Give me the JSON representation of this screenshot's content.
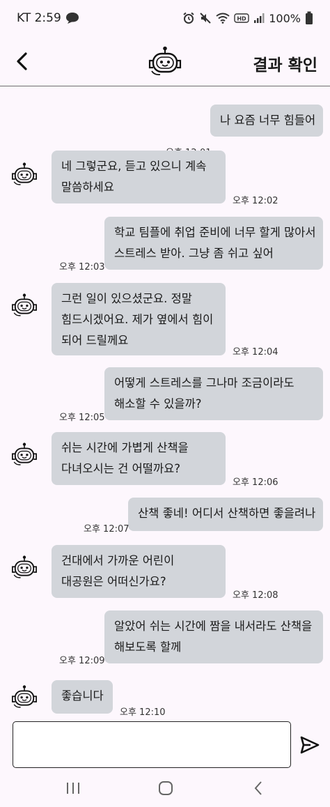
{
  "status_bar": {
    "carrier_time": "KT 2:59",
    "battery": "100%",
    "icons": [
      "chat-bubble-icon",
      "alarm-icon",
      "mute-icon",
      "wifi-icon",
      "hd-icon",
      "signal-icon",
      "battery-icon"
    ]
  },
  "header": {
    "back_icon": "chevron-left-icon",
    "bot_icon": "robot-icon",
    "result_label": "결과 확인"
  },
  "messages": [
    {
      "sender": "user",
      "lines": [
        "나 요즘 너무 힘들어"
      ],
      "time": "오후 12:01"
    },
    {
      "sender": "bot",
      "lines": [
        "네 그렇군요, 듣고 있으니 계속",
        "말씀하세요"
      ],
      "time": "오후 12:02"
    },
    {
      "sender": "user",
      "lines": [
        "학교 팀플에 취업 준비에 너무 할게 많아서",
        "스트레스 받아. 그냥 좀 쉬고 싶어"
      ],
      "time": "오후 12:03"
    },
    {
      "sender": "bot",
      "lines": [
        "그런 일이 있으셨군요. 정말",
        "힘드시겠어요. 제가 옆에서 힘이",
        "되어 드릴께요"
      ],
      "time": "오후 12:04"
    },
    {
      "sender": "user",
      "lines": [
        "어떻게 스트레스를 그나마 조금이라도",
        "해소할 수 있을까?"
      ],
      "time": "오후 12:05"
    },
    {
      "sender": "bot",
      "lines": [
        "쉬는 시간에 가볍게 산책을",
        "다녀오시는 건 어떨까요?"
      ],
      "time": "오후 12:06"
    },
    {
      "sender": "user",
      "lines": [
        "산책 좋네! 어디서 산책하면 좋을려나"
      ],
      "time": "오후 12:07"
    },
    {
      "sender": "bot",
      "lines": [
        "건대에서 가까운 어린이",
        "대공원은 어떠신가요?"
      ],
      "time": "오후 12:08"
    },
    {
      "sender": "user",
      "lines": [
        "알았어 쉬는 시간에 짬을 내서라도 산책을",
        "해보도록 할께"
      ],
      "time": "오후 12:09"
    },
    {
      "sender": "bot",
      "lines": [
        "좋습니다"
      ],
      "time": "오후 12:10"
    }
  ],
  "input": {
    "value": "",
    "placeholder": "",
    "send_icon": "send-icon"
  },
  "nav": {
    "icons": [
      "recent-apps-icon",
      "home-icon",
      "back-icon"
    ]
  },
  "colors": {
    "bubble": "#d2d5da",
    "background": "#fdf7fd"
  }
}
